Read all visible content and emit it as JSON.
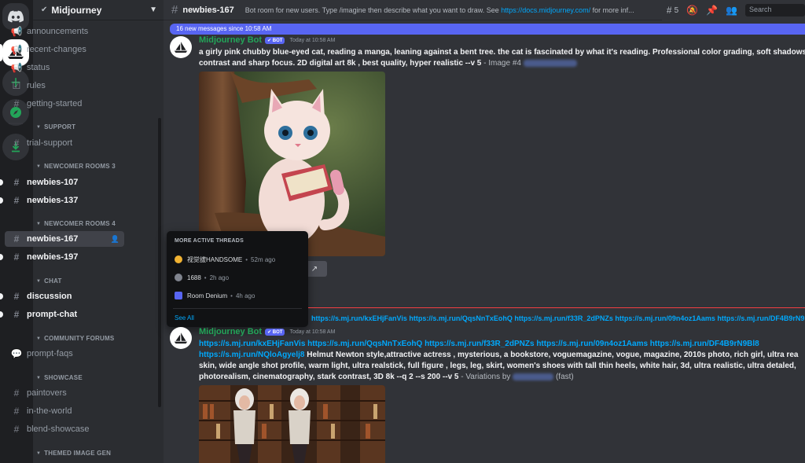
{
  "server": {
    "name": "Midjourney"
  },
  "sidebar": {
    "channels_top": [
      {
        "label": "announcements",
        "icon": "megaphone-icon"
      },
      {
        "label": "recent-changes",
        "icon": "megaphone-icon"
      },
      {
        "label": "status",
        "icon": "megaphone-icon"
      },
      {
        "label": "rules",
        "icon": "checkbox-icon"
      },
      {
        "label": "getting-started",
        "icon": "hash-icon"
      }
    ],
    "support": {
      "title": "SUPPORT",
      "items": [
        "trial-support"
      ]
    },
    "newcomer3": {
      "title": "NEWCOMER ROOMS 3",
      "items": [
        "newbies-107",
        "newbies-137"
      ]
    },
    "newcomer4": {
      "title": "NEWCOMER ROOMS 4",
      "items": [
        "newbies-167",
        "newbies-197"
      ]
    },
    "chat": {
      "title": "CHAT",
      "items": [
        "discussion",
        "prompt-chat"
      ]
    },
    "forums": {
      "title": "COMMUNITY FORUMS",
      "items": [
        "prompt-faqs"
      ]
    },
    "showcase": {
      "title": "SHOWCASE",
      "items": [
        "paintovers",
        "in-the-world",
        "blend-showcase"
      ]
    },
    "themed": {
      "title": "THEMED IMAGE GEN"
    }
  },
  "topbar": {
    "channel": "newbies-167",
    "topic_prefix": "Bot room for new users. Type /imagine then describe what you want to draw. See ",
    "topic_link": "https://docs.midjourney.com/",
    "topic_suffix": " for more inf...",
    "threads_count": "5",
    "search_placeholder": "Search"
  },
  "new_messages": "16 new messages since 10:58 AM",
  "message1": {
    "author": "Midjourney Bot",
    "tag": "BOT",
    "time": "Today at 10:58 AM",
    "line1": "a girly pink chubby blue-eyed cat, reading a manga, leaning against a bent tree. the cat is fascinated by what it's reading. Professional color grading, soft shadows,",
    "line2": "contrast and sharp focus. 2D digital art 8k , best quality, hyper realistic --v 5",
    "meta": " - Image #4 "
  },
  "threads_popup": {
    "title": "MORE ACTIVE THREADS",
    "items": [
      {
        "name": "视觉拔HANDSOME",
        "ago": "52m ago",
        "color": "#f0b232"
      },
      {
        "name": "1688",
        "ago": "2h ago",
        "color": "#80848e"
      },
      {
        "name": "Room Denium",
        "ago": "4h ago",
        "color": "#5865f2"
      }
    ],
    "see_all": "See All"
  },
  "link_strip": "https://s.mj.run/kxEHjFanVis https://s.mj.run/QqsNnTxEohQ https://s.mj.run/f33R_2dPNZs https://s.mj.run/09n4oz1Aams https://s.mj.run/DF4B9rN9Bl8 http",
  "message2": {
    "author": "Midjourney Bot",
    "tag": "BOT",
    "time": "Today at 10:58 AM",
    "links1": "https://s.mj.run/kxEHjFanVis https://s.mj.run/QqsNnTxEohQ https://s.mj.run/f33R_2dPNZs https://s.mj.run/09n4oz1Aams https://s.mj.run/DF4B9rN9Bl8",
    "links2": "https://s.mj.run/NQloAgyelj8",
    "line2_rest": " Helmut Newton style,attractive actress , mysterious, a bookstore, voguemagazine, vogue, magazine, 2010s photo, rich girl, ultra rea",
    "line3": "skin, wide angle shot profile, warm light, ultra realstick, full figure , legs, leg, skirt, women's shoes with tall thin heels, white hair, 3d, ultra realistic, ultra detaled,",
    "line4": "photorealism, cinematography, stark contrast, 3D 8k --q 2 --s 200 --v 5",
    "meta": " - Variations by ",
    "meta_end": " (fast)"
  }
}
